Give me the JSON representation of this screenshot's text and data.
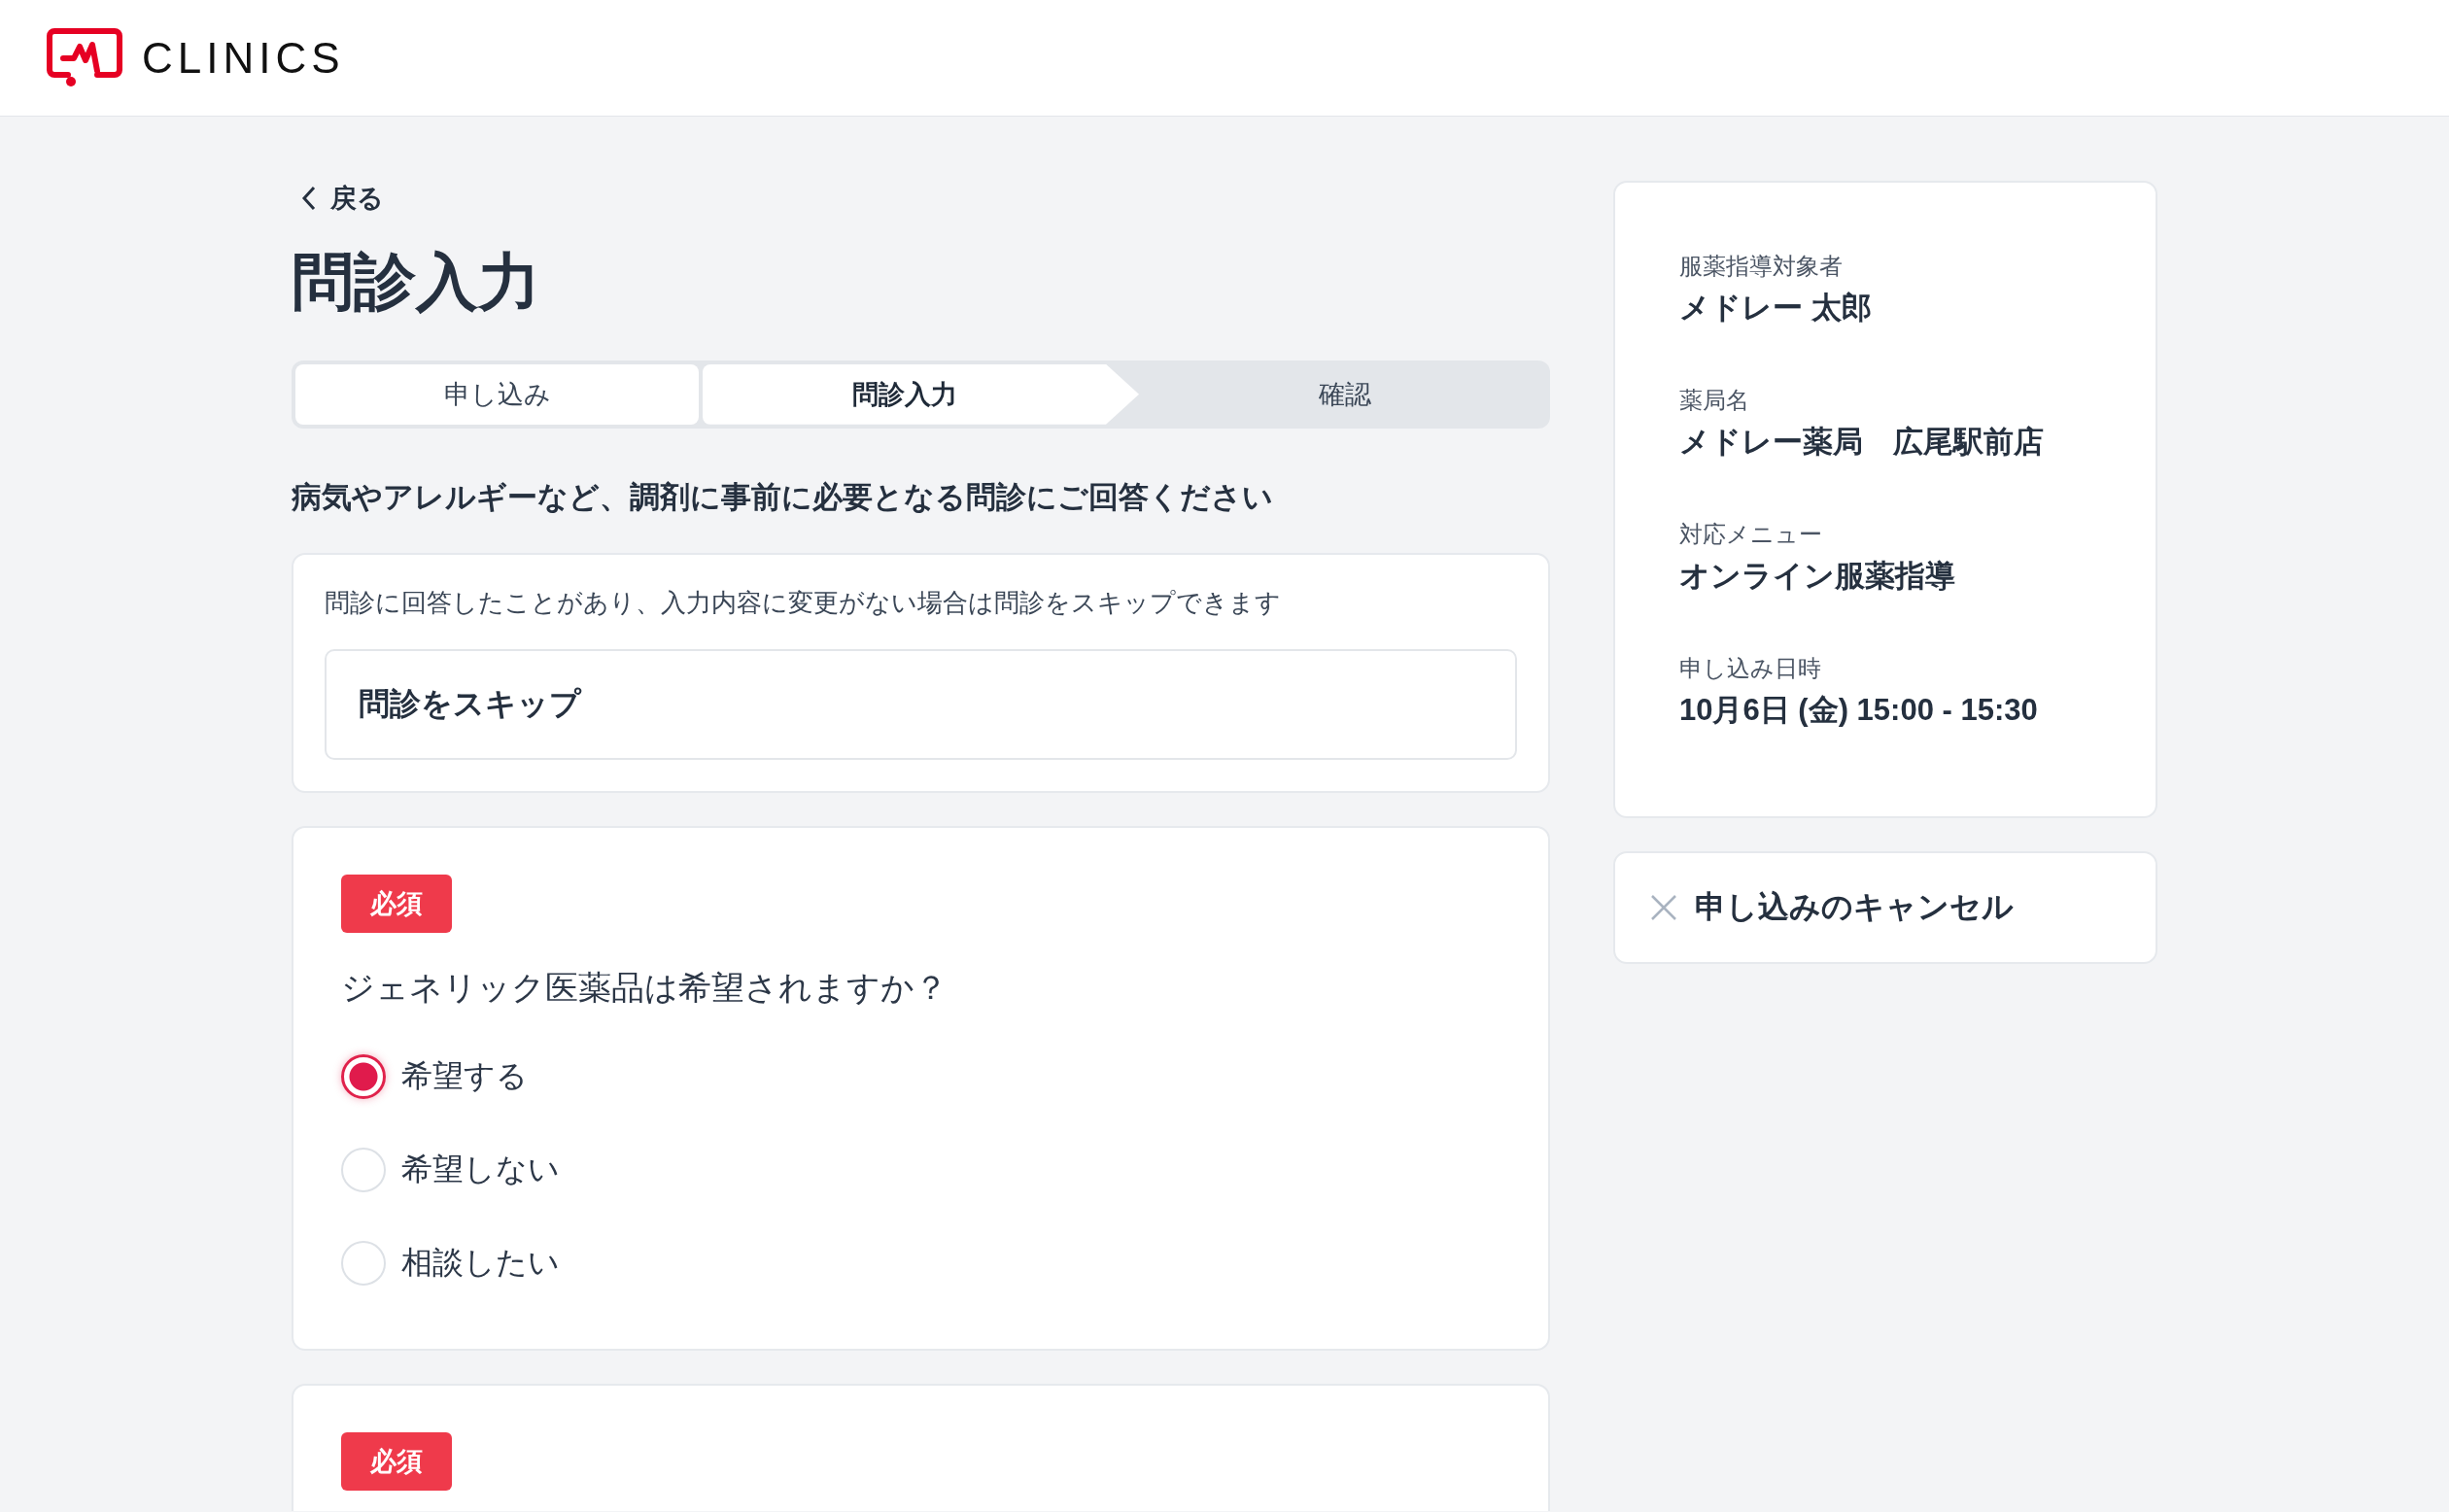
{
  "header": {
    "logo_text": "CLINICS"
  },
  "back_link": "戻る",
  "page_title": "問診入力",
  "steps": [
    {
      "label": "申し込み",
      "done": true,
      "selected": false
    },
    {
      "label": "問診入力",
      "done": false,
      "selected": true
    },
    {
      "label": "確認",
      "done": false,
      "selected": false
    }
  ],
  "intro": "病気やアレルギーなど、調剤に事前に必要となる問診にご回答ください",
  "skip_card": {
    "note": "問診に回答したことがあり、入力内容に変更がない場合は問診をスキップできます",
    "button": "問診をスキップ"
  },
  "questions": [
    {
      "required_badge": "必須",
      "text": "ジェネリック医薬品は希望されますか？",
      "options": [
        {
          "label": "希望する",
          "selected": true
        },
        {
          "label": "希望しない",
          "selected": false
        },
        {
          "label": "相談したい",
          "selected": false
        }
      ]
    },
    {
      "required_badge": "必須"
    }
  ],
  "summary": [
    {
      "label": "服薬指導対象者",
      "value": "メドレー 太郎"
    },
    {
      "label": "薬局名",
      "value": "メドレー薬局　広尾駅前店"
    },
    {
      "label": "対応メニュー",
      "value": "オンライン服薬指導"
    },
    {
      "label": "申し込み日時",
      "value": "10月6日 (金) 15:00 - 15:30"
    }
  ],
  "cancel_button": "申し込みのキャンセル"
}
